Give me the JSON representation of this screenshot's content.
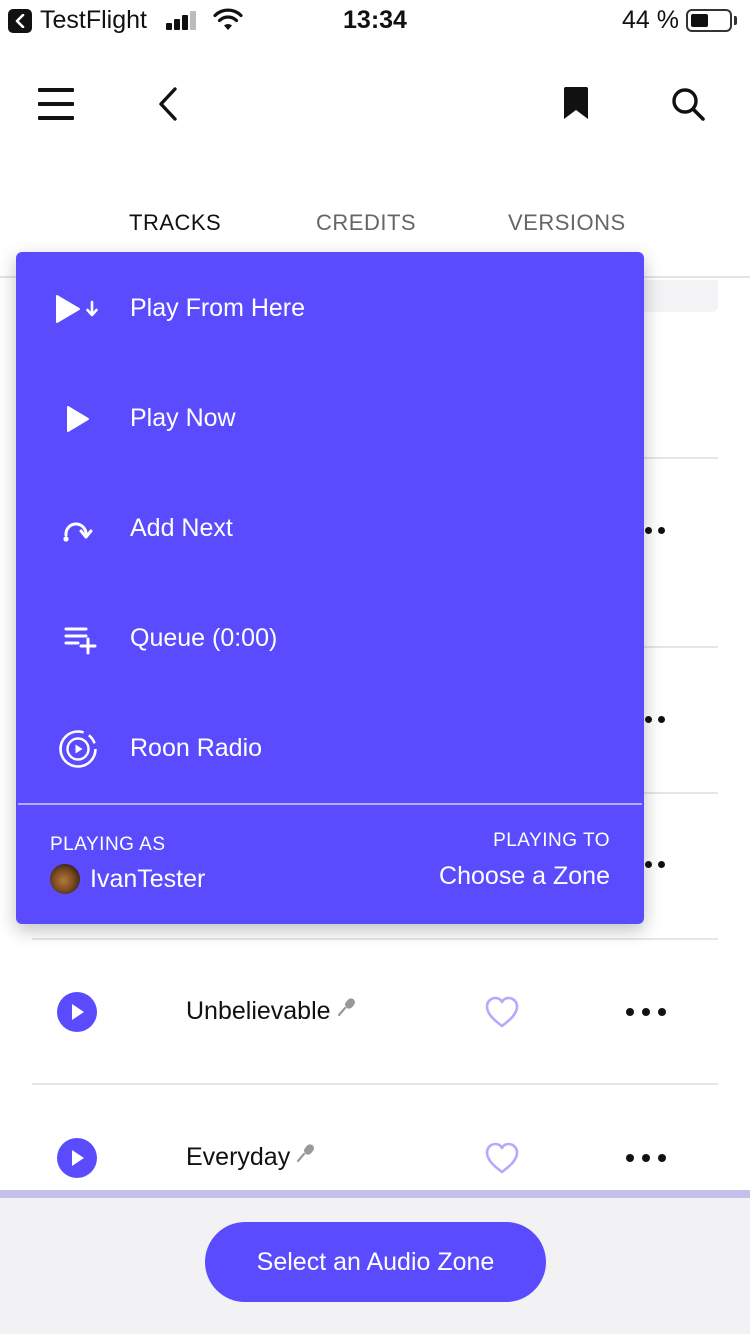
{
  "status_bar": {
    "app_name": "TestFlight",
    "time": "13:34",
    "battery_percent": "44 %",
    "battery_level": 0.44
  },
  "tabs": [
    {
      "label": "TRACKS",
      "active": true
    },
    {
      "label": "CREDITS",
      "active": false
    },
    {
      "label": "VERSIONS",
      "active": false
    }
  ],
  "context_menu": {
    "items": [
      {
        "label": "Play From Here",
        "icon": "play-from-here-icon"
      },
      {
        "label": "Play Now",
        "icon": "play-icon"
      },
      {
        "label": "Add Next",
        "icon": "add-next-icon"
      },
      {
        "label": "Queue (0:00)",
        "icon": "queue-add-icon"
      },
      {
        "label": "Roon Radio",
        "icon": "radio-icon"
      }
    ],
    "playing_as_label": "PLAYING AS",
    "user_name": "IvanTester",
    "playing_to_label": "PLAYING TO",
    "zone_label": "Choose a Zone"
  },
  "tracks": [
    {
      "title": "Unbelievable",
      "favorited": false
    },
    {
      "title": "Everyday",
      "favorited": false
    }
  ],
  "bottom": {
    "zone_button_label": "Select an Audio Zone"
  },
  "colors": {
    "accent": "#5a4bff",
    "heart": "#b3a9ff",
    "bottom_line": "#c4c0ee"
  }
}
